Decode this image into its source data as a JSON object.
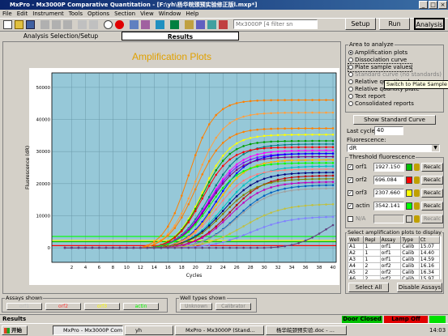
{
  "window": {
    "title": "MxPro - Mx3000P Comparative Quantitation - [F:\\yh\\杨华皖颈预实验修正版l.mxp*]"
  },
  "menu": [
    "File",
    "Edit",
    "Instrument",
    "Tools",
    "Options",
    "Section",
    "View",
    "Window",
    "Help"
  ],
  "toolbar": {
    "instrument_select": "Mx3000P [4 filter sn",
    "setup_label": "Setup",
    "run_label": "Run",
    "analysis_label": "Analysis"
  },
  "tabs": {
    "left": "Analysis Selection/Setup",
    "right": "Results"
  },
  "chart_data": {
    "type": "line",
    "title": "Amplification Plots",
    "xlabel": "Cycles",
    "ylabel": "Fluorescence (dR)",
    "xticks": [
      2,
      4,
      6,
      8,
      10,
      12,
      14,
      16,
      18,
      20,
      22,
      24,
      26,
      28,
      30,
      32,
      34,
      36,
      38,
      40
    ],
    "yticks": [
      "0",
      "10000",
      "20000",
      "30000",
      "40000",
      "50000"
    ],
    "xlim": [
      1,
      40
    ],
    "ylim": [
      -3000,
      53000
    ],
    "grid": true,
    "series": [
      {
        "color": "#ff8000",
        "start": 14,
        "plateau": 47000,
        "steep": 0.55
      },
      {
        "color": "#ffa040",
        "start": 15,
        "plateau": 43000,
        "steep": 0.5
      },
      {
        "color": "#ff8000",
        "start": 15,
        "plateau": 38000,
        "steep": 0.5
      },
      {
        "color": "#ffff00",
        "start": 16,
        "plateau": 36000,
        "steep": 0.5
      },
      {
        "color": "#00a000",
        "start": 16,
        "plateau": 34000,
        "steep": 0.5
      },
      {
        "color": "#008080",
        "start": 17,
        "plateau": 33000,
        "steep": 0.45
      },
      {
        "color": "#ff0000",
        "start": 16,
        "plateau": 32000,
        "steep": 0.5
      },
      {
        "color": "#ff00ff",
        "start": 17,
        "plateau": 31000,
        "steep": 0.45
      },
      {
        "color": "#8000ff",
        "start": 17,
        "plateau": 30000,
        "steep": 0.45
      },
      {
        "color": "#0000ff",
        "start": 18,
        "plateau": 30000,
        "steep": 0.45
      },
      {
        "color": "#800080",
        "start": 17,
        "plateau": 29000,
        "steep": 0.45
      },
      {
        "color": "#804000",
        "start": 18,
        "plateau": 28000,
        "steep": 0.45
      },
      {
        "color": "#ffc000",
        "start": 18,
        "plateau": 28000,
        "steep": 0.45
      },
      {
        "color": "#00ff00",
        "start": 17,
        "plateau": 27000,
        "steep": 0.45
      },
      {
        "color": "#00c0c0",
        "start": 19,
        "plateau": 26000,
        "steep": 0.4
      },
      {
        "color": "#ff8080",
        "start": 18,
        "plateau": 25000,
        "steep": 0.45
      },
      {
        "color": "#000080",
        "start": 19,
        "plateau": 24000,
        "steep": 0.4
      },
      {
        "color": "#c00000",
        "start": 20,
        "plateau": 23000,
        "steep": 0.4
      },
      {
        "color": "#808000",
        "start": 19,
        "plateau": 22000,
        "steep": 0.4
      },
      {
        "color": "#c000c0",
        "start": 20,
        "plateau": 21000,
        "steep": 0.4
      },
      {
        "color": "#0060c0",
        "start": 21,
        "plateau": 20000,
        "steep": 0.4
      },
      {
        "color": "#a0a0a0",
        "start": 21,
        "plateau": 19000,
        "steep": 0.4
      },
      {
        "color": "#c0c040",
        "start": 22,
        "plateau": 14000,
        "steep": 0.35
      },
      {
        "color": "#8080ff",
        "start": 23,
        "plateau": 10000,
        "steep": 0.35
      },
      {
        "color": "#604080",
        "start": 34,
        "plateau": 12000,
        "steep": 0.45
      }
    ],
    "thresholds": [
      {
        "color": "#00c000",
        "value": 1927
      },
      {
        "color": "#ff0000",
        "value": 696
      },
      {
        "color": "#ffff00",
        "value": 2307
      },
      {
        "color": "#00ff00",
        "value": 3542
      }
    ]
  },
  "area_to_analyze": {
    "legend": "Area to analyze",
    "options": [
      "Amplification plots",
      "Dissociation curve",
      "Plate sample values",
      "Standard curve (no standards)",
      "Relative quantity chart",
      "Relative quantity plate",
      "Text report",
      "Consolidated reports"
    ],
    "tooltip": "Switch to Plate Sample Values",
    "selected": 0
  },
  "show_std_curve": "Show Standard Curve",
  "last_cycle": {
    "label": "Last cycle:",
    "value": "40"
  },
  "fluorescence": {
    "label": "Fluorescence:",
    "value": "dR"
  },
  "threshold": {
    "legend": "Threshold fluorescence",
    "rows": [
      {
        "name": "orf1",
        "value": "1927.150",
        "color": "#00c000",
        "recalc": "Recalc"
      },
      {
        "name": "orf2",
        "value": "696.084",
        "color": "#ff0000",
        "recalc": "Recalc"
      },
      {
        "name": "orf3",
        "value": "2307.660",
        "color": "#ffff00",
        "recalc": "Recalc"
      },
      {
        "name": "actin",
        "value": "3542.141",
        "color": "#00ff00",
        "recalc": "Recalc"
      },
      {
        "name": "N/A",
        "value": "",
        "color": "#d4d0c8",
        "recalc": "Recalc"
      }
    ]
  },
  "wells": {
    "legend": "Select amplification plots to display",
    "headers": [
      "Well",
      "Repl",
      "Assay",
      "Type",
      "Ct"
    ],
    "rows": [
      [
        "A1",
        "1",
        "orf1",
        "Calib",
        "15.07"
      ],
      [
        "A2",
        "1",
        "orf1",
        "Calib",
        "14.40"
      ],
      [
        "A3",
        "1",
        "orf1",
        "Calib",
        "14.59"
      ],
      [
        "A4",
        "2",
        "orf2",
        "Calib",
        "16.16"
      ],
      [
        "A5",
        "2",
        "orf2",
        "Calib",
        "16.34"
      ],
      [
        "A6",
        "2",
        "orf2",
        "Calib",
        "15.97"
      ]
    ],
    "select_all": "Select All",
    "disable_assays": "Disable Assays"
  },
  "assays_shown": {
    "label": "Assays shown",
    "items": [
      {
        "name": "orf1",
        "color": "#c0c0c0"
      },
      {
        "name": "orf2",
        "color": "#ff4040"
      },
      {
        "name": "orf3",
        "color": "#ffff00"
      },
      {
        "name": "actin",
        "color": "#00ff00"
      }
    ]
  },
  "well_types_shown": {
    "label": "Well types shown",
    "items": [
      "Unknown",
      "Calibrator"
    ]
  },
  "status": {
    "left": "Results",
    "door": "Door Closed",
    "lamp": "Lamp Off"
  },
  "taskbar": {
    "start": "开始",
    "tasks": [
      "MxPro - Mx3000P Compara...",
      "yh",
      "MxPro - Mx3000P (Stand...",
      "杨华皖颈预实验.doc - ..."
    ],
    "clock": "14:03"
  }
}
